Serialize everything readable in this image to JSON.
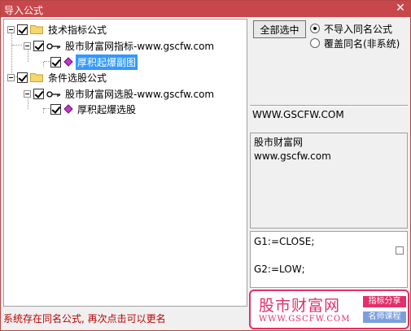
{
  "window": {
    "title": "导入公式",
    "close_glyph": "✕"
  },
  "tree": {
    "nodes": [
      {
        "label": "技术指标公式",
        "type": "folder",
        "checked": true,
        "level": 0
      },
      {
        "label": "股市财富网指标-www.gscfw.com",
        "type": "key",
        "checked": true,
        "level": 1
      },
      {
        "label": "厚积起爆副图",
        "type": "formula",
        "checked": true,
        "level": 2,
        "selected": true
      },
      {
        "label": "条件选股公式",
        "type": "folder",
        "checked": true,
        "level": 0
      },
      {
        "label": "股市财富网选股-www.gscfw.com",
        "type": "key",
        "checked": true,
        "level": 1
      },
      {
        "label": "厚积起爆选股",
        "type": "formula",
        "checked": true,
        "level": 2
      }
    ]
  },
  "status": "系统存在同名公式, 再次点击可以更名",
  "controls": {
    "select_all": "全部选中",
    "radio_skip": "不导入同名公式",
    "radio_overwrite": "覆盖同名(非系统)",
    "radio_selected": "skip"
  },
  "url_text": "WWW.GSCFW.COM",
  "description": {
    "line1": "股市财富网",
    "line2": "www.gscfw.com"
  },
  "code": {
    "line1": "G1:=CLOSE;",
    "line2": "G2:=LOW;"
  },
  "brand": {
    "name": "股市财富网",
    "site": "WWW.GSCFW.COM",
    "tag1": "指标分享",
    "tag2": "名师课程",
    "accent": "#e42f6a",
    "accent2": "#7a9fe0"
  },
  "colors": {
    "title_bar": "#c8474c",
    "selection": "#3399ff",
    "status_text": "#c00000"
  }
}
